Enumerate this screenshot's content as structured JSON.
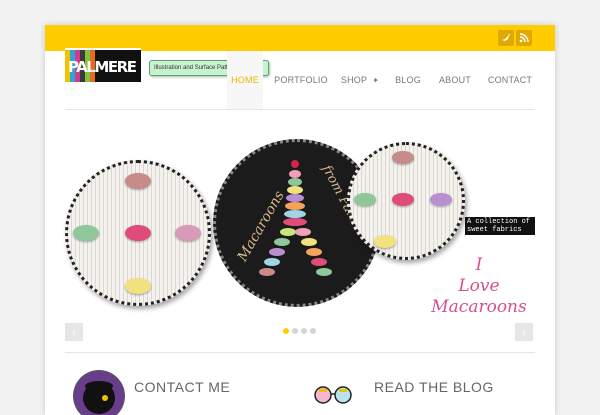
{
  "header": {
    "tagline": "Illustration and Surface Pattern Design",
    "logo_alt": "PALMERE"
  },
  "social": [
    "twitter-icon",
    "rss-icon"
  ],
  "nav": {
    "items": [
      {
        "label": "HOME",
        "active": true
      },
      {
        "label": "PORTFOLIO",
        "active": false
      },
      {
        "label": "SHOP",
        "active": false
      },
      {
        "label": "BLOG",
        "active": false
      },
      {
        "label": "ABOUT",
        "active": false
      },
      {
        "label": "CONTACT",
        "active": false
      }
    ]
  },
  "slider": {
    "badge_text": "A collection of sweet fabrics",
    "love_text": [
      "I",
      "Love",
      "Macaroons"
    ],
    "center_text_1": "Macaroons",
    "center_text_2": "from Paris",
    "prev": "‹",
    "next": "›",
    "pagination": {
      "count": 4,
      "active_index": 0
    }
  },
  "sections": {
    "contact": "CONTACT ME",
    "blog": "READ THE BLOG"
  },
  "colors": {
    "accent": "#ffcc00",
    "background": "#f2f2f2",
    "pink_text": "#d4508a"
  }
}
